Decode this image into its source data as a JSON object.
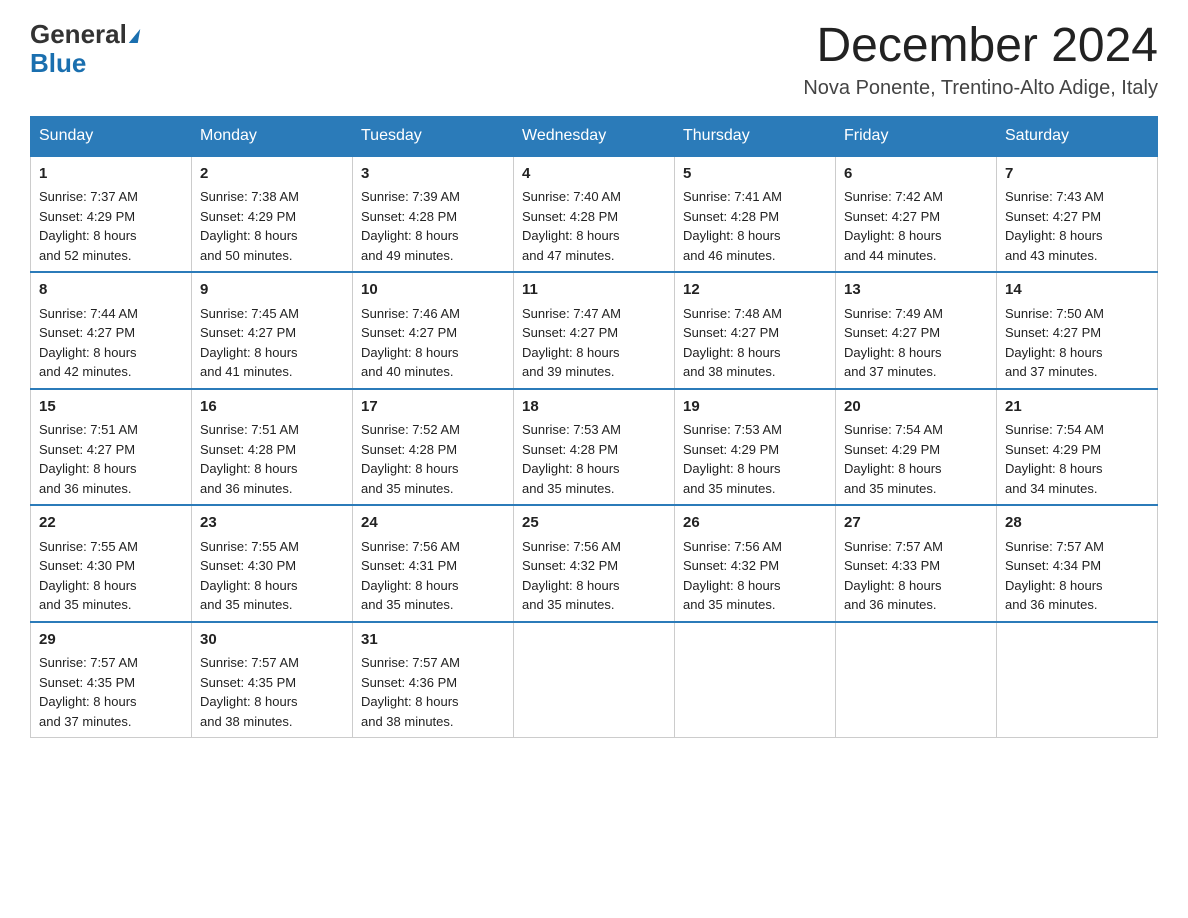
{
  "logo": {
    "general": "General",
    "blue": "Blue"
  },
  "title": "December 2024",
  "location": "Nova Ponente, Trentino-Alto Adige, Italy",
  "headers": [
    "Sunday",
    "Monday",
    "Tuesday",
    "Wednesday",
    "Thursday",
    "Friday",
    "Saturday"
  ],
  "weeks": [
    [
      {
        "day": "1",
        "sunrise": "7:37 AM",
        "sunset": "4:29 PM",
        "daylight": "8 hours and 52 minutes."
      },
      {
        "day": "2",
        "sunrise": "7:38 AM",
        "sunset": "4:29 PM",
        "daylight": "8 hours and 50 minutes."
      },
      {
        "day": "3",
        "sunrise": "7:39 AM",
        "sunset": "4:28 PM",
        "daylight": "8 hours and 49 minutes."
      },
      {
        "day": "4",
        "sunrise": "7:40 AM",
        "sunset": "4:28 PM",
        "daylight": "8 hours and 47 minutes."
      },
      {
        "day": "5",
        "sunrise": "7:41 AM",
        "sunset": "4:28 PM",
        "daylight": "8 hours and 46 minutes."
      },
      {
        "day": "6",
        "sunrise": "7:42 AM",
        "sunset": "4:27 PM",
        "daylight": "8 hours and 44 minutes."
      },
      {
        "day": "7",
        "sunrise": "7:43 AM",
        "sunset": "4:27 PM",
        "daylight": "8 hours and 43 minutes."
      }
    ],
    [
      {
        "day": "8",
        "sunrise": "7:44 AM",
        "sunset": "4:27 PM",
        "daylight": "8 hours and 42 minutes."
      },
      {
        "day": "9",
        "sunrise": "7:45 AM",
        "sunset": "4:27 PM",
        "daylight": "8 hours and 41 minutes."
      },
      {
        "day": "10",
        "sunrise": "7:46 AM",
        "sunset": "4:27 PM",
        "daylight": "8 hours and 40 minutes."
      },
      {
        "day": "11",
        "sunrise": "7:47 AM",
        "sunset": "4:27 PM",
        "daylight": "8 hours and 39 minutes."
      },
      {
        "day": "12",
        "sunrise": "7:48 AM",
        "sunset": "4:27 PM",
        "daylight": "8 hours and 38 minutes."
      },
      {
        "day": "13",
        "sunrise": "7:49 AM",
        "sunset": "4:27 PM",
        "daylight": "8 hours and 37 minutes."
      },
      {
        "day": "14",
        "sunrise": "7:50 AM",
        "sunset": "4:27 PM",
        "daylight": "8 hours and 37 minutes."
      }
    ],
    [
      {
        "day": "15",
        "sunrise": "7:51 AM",
        "sunset": "4:27 PM",
        "daylight": "8 hours and 36 minutes."
      },
      {
        "day": "16",
        "sunrise": "7:51 AM",
        "sunset": "4:28 PM",
        "daylight": "8 hours and 36 minutes."
      },
      {
        "day": "17",
        "sunrise": "7:52 AM",
        "sunset": "4:28 PM",
        "daylight": "8 hours and 35 minutes."
      },
      {
        "day": "18",
        "sunrise": "7:53 AM",
        "sunset": "4:28 PM",
        "daylight": "8 hours and 35 minutes."
      },
      {
        "day": "19",
        "sunrise": "7:53 AM",
        "sunset": "4:29 PM",
        "daylight": "8 hours and 35 minutes."
      },
      {
        "day": "20",
        "sunrise": "7:54 AM",
        "sunset": "4:29 PM",
        "daylight": "8 hours and 35 minutes."
      },
      {
        "day": "21",
        "sunrise": "7:54 AM",
        "sunset": "4:29 PM",
        "daylight": "8 hours and 34 minutes."
      }
    ],
    [
      {
        "day": "22",
        "sunrise": "7:55 AM",
        "sunset": "4:30 PM",
        "daylight": "8 hours and 35 minutes."
      },
      {
        "day": "23",
        "sunrise": "7:55 AM",
        "sunset": "4:30 PM",
        "daylight": "8 hours and 35 minutes."
      },
      {
        "day": "24",
        "sunrise": "7:56 AM",
        "sunset": "4:31 PM",
        "daylight": "8 hours and 35 minutes."
      },
      {
        "day": "25",
        "sunrise": "7:56 AM",
        "sunset": "4:32 PM",
        "daylight": "8 hours and 35 minutes."
      },
      {
        "day": "26",
        "sunrise": "7:56 AM",
        "sunset": "4:32 PM",
        "daylight": "8 hours and 35 minutes."
      },
      {
        "day": "27",
        "sunrise": "7:57 AM",
        "sunset": "4:33 PM",
        "daylight": "8 hours and 36 minutes."
      },
      {
        "day": "28",
        "sunrise": "7:57 AM",
        "sunset": "4:34 PM",
        "daylight": "8 hours and 36 minutes."
      }
    ],
    [
      {
        "day": "29",
        "sunrise": "7:57 AM",
        "sunset": "4:35 PM",
        "daylight": "8 hours and 37 minutes."
      },
      {
        "day": "30",
        "sunrise": "7:57 AM",
        "sunset": "4:35 PM",
        "daylight": "8 hours and 38 minutes."
      },
      {
        "day": "31",
        "sunrise": "7:57 AM",
        "sunset": "4:36 PM",
        "daylight": "8 hours and 38 minutes."
      },
      null,
      null,
      null,
      null
    ]
  ]
}
